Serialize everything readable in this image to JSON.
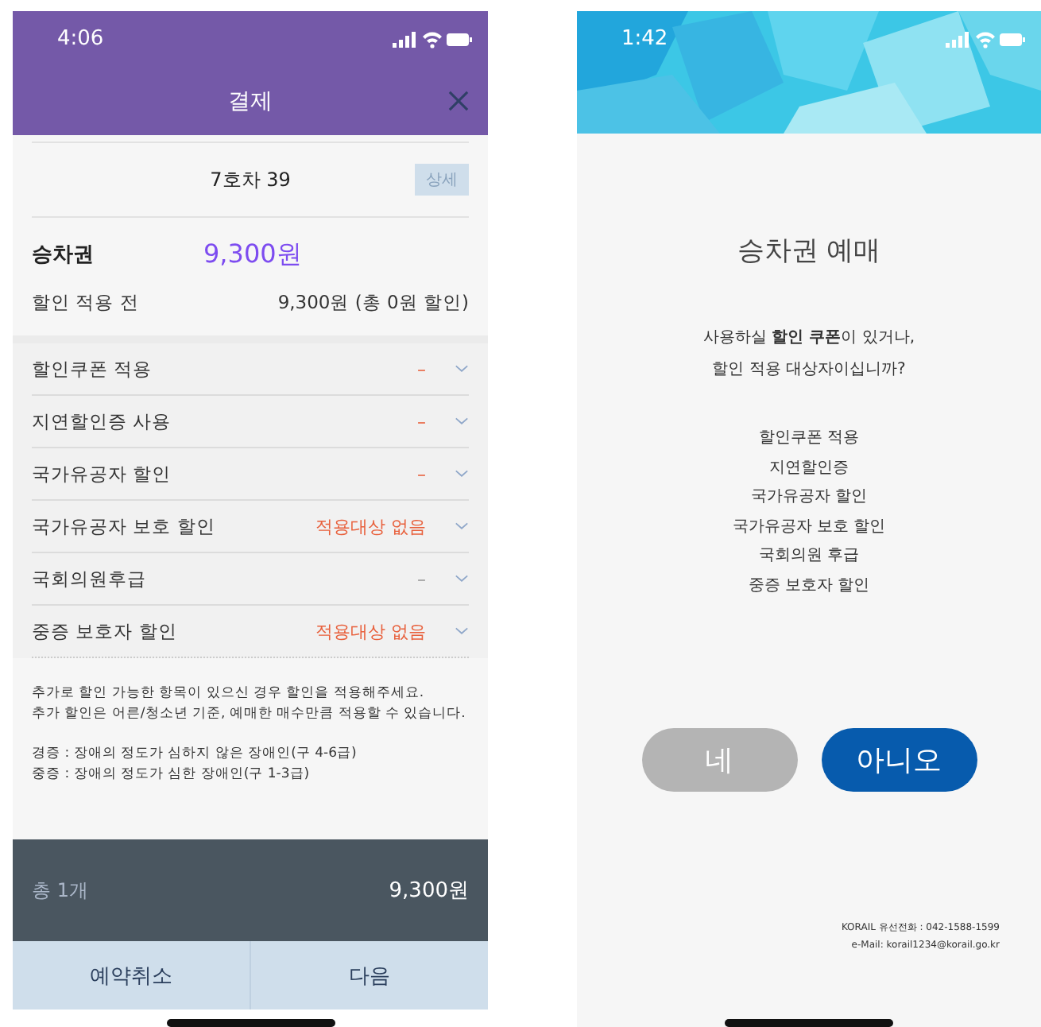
{
  "payment_screen": {
    "status_bar": {
      "time": "4:06"
    },
    "header": {
      "title": "결제"
    },
    "car": {
      "label": "7호차 39",
      "detail_button": "상세"
    },
    "fare": {
      "label": "승차권",
      "amount": "9,300원"
    },
    "before_discount": {
      "label": "할인 적용 전",
      "value": "9,300원 (총 0원 할인)"
    },
    "discounts": [
      {
        "label": "할인쿠폰 적용",
        "value": "–",
        "kind": "dash"
      },
      {
        "label": "지연할인증 사용",
        "value": "–",
        "kind": "dash"
      },
      {
        "label": "국가유공자 할인",
        "value": "–",
        "kind": "dash"
      },
      {
        "label": "국가유공자 보호 할인",
        "value": "적용대상 없음",
        "kind": "note"
      },
      {
        "label": "국회의원후급",
        "value": "–",
        "kind": "muted"
      },
      {
        "label": "중증 보호자 할인",
        "value": "적용대상 없음",
        "kind": "note"
      }
    ],
    "notes": [
      [
        "추가로 할인 가능한 항목이 있으신 경우 할인을 적용해주세요.",
        "추가 할인은 어른/청소년 기준, 예매한 매수만큼 적용할 수 있습니다."
      ],
      [
        "경증 : 장애의 정도가 심하지 않은 장애인(구 4-6급)",
        "중증 : 장애의 정도가 심한 장애인(구 1-3급)"
      ]
    ],
    "total": {
      "count": "총 1개",
      "amount": "9,300원"
    },
    "buttons": [
      "예약취소",
      "다음"
    ]
  },
  "booking_screen": {
    "status_bar": {
      "time": "1:42"
    },
    "title": "승차권 예매",
    "question": [
      "사용하실 **할인 쿠폰**이 있거나,",
      "할인 적용 대상자이십니까?"
    ],
    "options": [
      "할인쿠폰 적용",
      "지연할인증",
      "국가유공자 할인",
      "국가유공자 보호 할인",
      "국회의원 후급",
      "중증 보호자 할인"
    ],
    "buttons": [
      {
        "label": "네",
        "kind": "secondary"
      },
      {
        "label": "아니오",
        "kind": "primary"
      }
    ],
    "footer": [
      "KORAIL 유선전화 : 042-1588-1599",
      "e-Mail: korail1234@korail.go.kr"
    ]
  }
}
